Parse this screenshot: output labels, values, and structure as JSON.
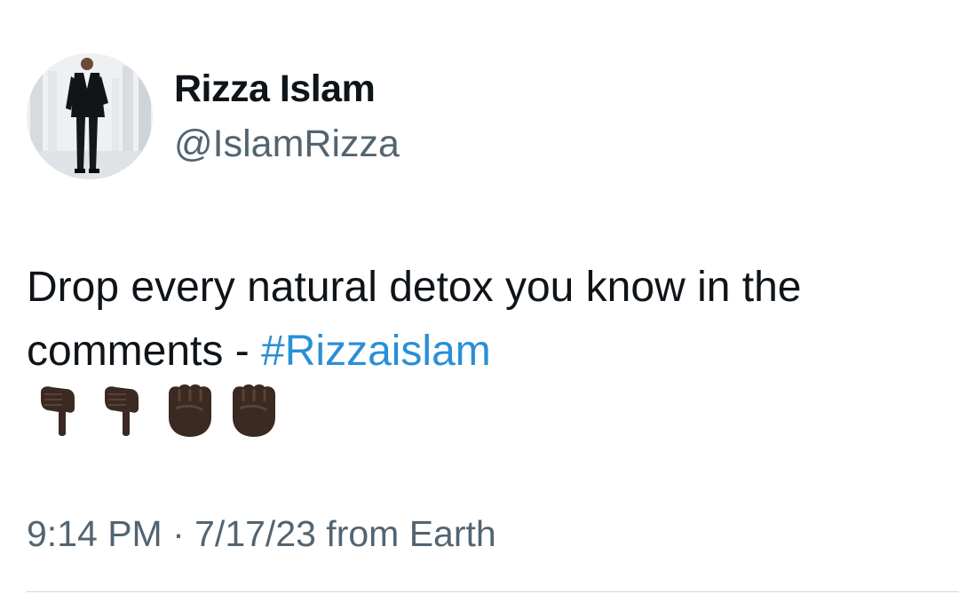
{
  "author": {
    "display_name": "Rizza Islam",
    "handle": "@IslamRizza",
    "avatar_icon": "profile-photo-man-in-suit"
  },
  "tweet": {
    "text_main": "Drop every natural detox you know in the comments - ",
    "hashtag": "#Rizzaislam",
    "emojis": [
      "backhand-index-pointing-down-dark",
      "backhand-index-pointing-down-dark",
      "raised-fist-dark",
      "raised-fist-dark"
    ]
  },
  "meta": {
    "timestamp": "9:14 PM · 7/17/23 from Earth"
  },
  "colors": {
    "text": "#0f1419",
    "secondary": "#536471",
    "hashtag": "#2a8fd6",
    "divider": "#cfd9de",
    "emoji_skin": "#3b2a22"
  }
}
